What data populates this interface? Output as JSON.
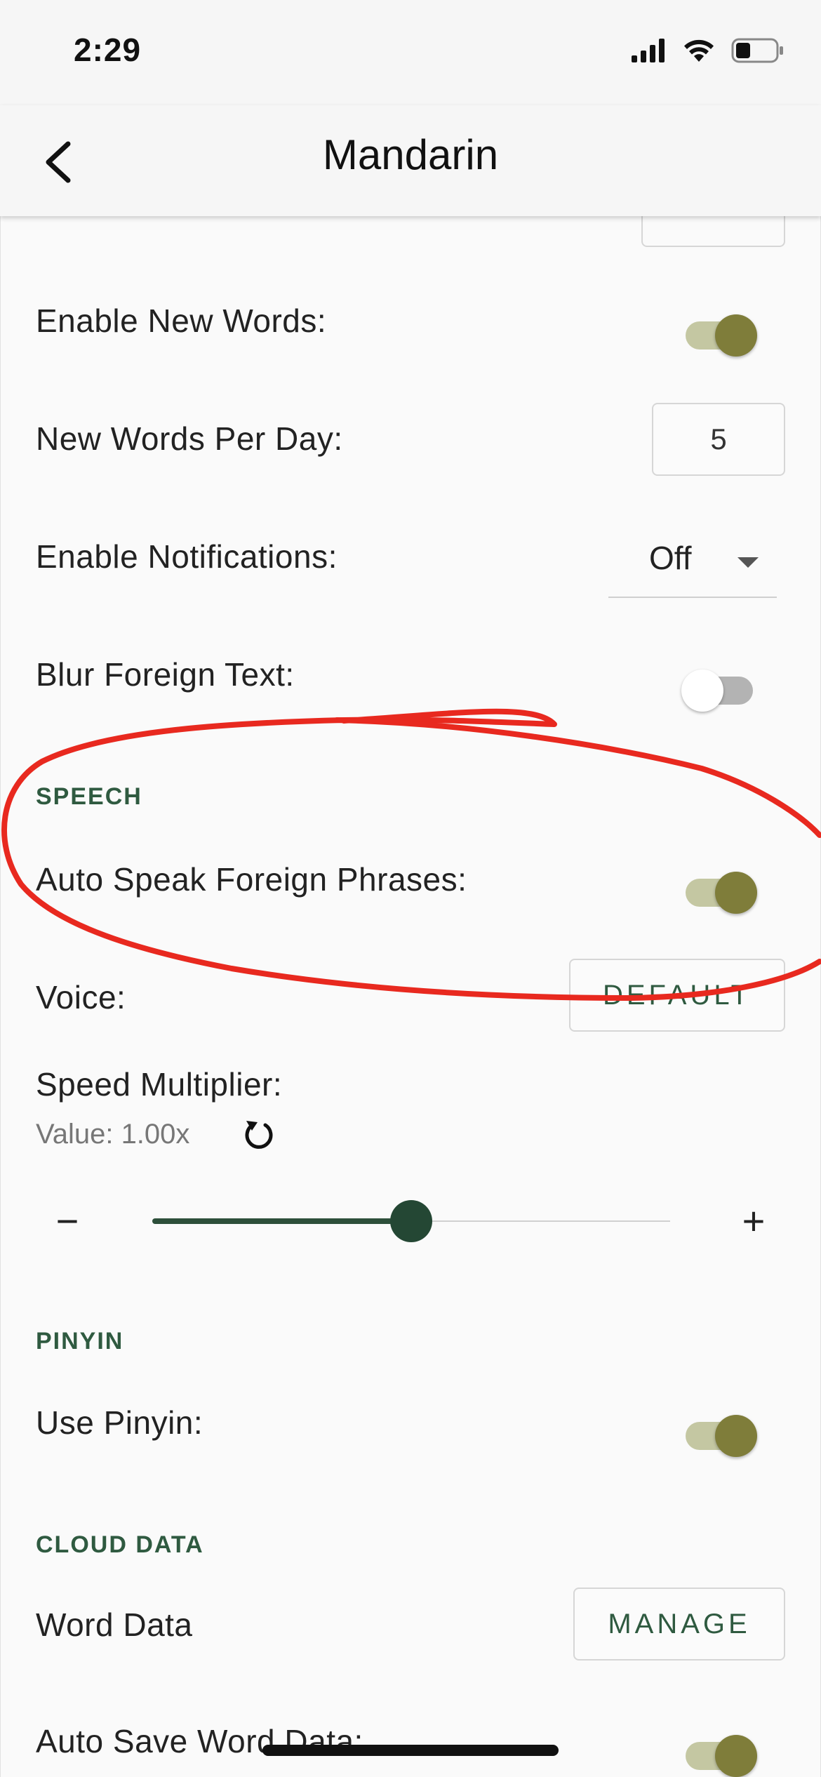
{
  "status_bar": {
    "time": "2:29"
  },
  "nav": {
    "title": "Mandarin"
  },
  "settings": {
    "enable_new_words": {
      "label": "Enable New Words:",
      "on": true
    },
    "new_words_per_day": {
      "label": "New Words Per Day:",
      "value": "5"
    },
    "enable_notifications": {
      "label": "Enable Notifications:",
      "selected": "Off"
    },
    "blur_foreign_text": {
      "label": "Blur Foreign Text:",
      "on": false
    }
  },
  "speech": {
    "header": "SPEECH",
    "auto_speak": {
      "label": "Auto Speak Foreign Phrases:",
      "on": true
    },
    "voice": {
      "label": "Voice:",
      "button": "DEFAULT"
    },
    "speed": {
      "label": "Speed Multiplier:",
      "value_text": "Value: 1.00x",
      "minus": "−",
      "plus": "+",
      "fraction": 0.5
    }
  },
  "pinyin": {
    "header": "PINYIN",
    "use_pinyin": {
      "label": "Use Pinyin:",
      "on": true
    }
  },
  "cloud_data": {
    "header": "CLOUD DATA",
    "word_data": {
      "label": "Word Data",
      "button": "MANAGE"
    },
    "auto_save": {
      "label": "Auto Save Word Data:",
      "on": true
    }
  },
  "colors": {
    "accent_green": "#2f5a40",
    "toggle_on": "#7f7d3a",
    "annotation_red": "#e8291f"
  },
  "icons": {
    "back": "chevron-left-icon",
    "reset": "reset-icon",
    "dropdown": "caret-down-icon"
  }
}
